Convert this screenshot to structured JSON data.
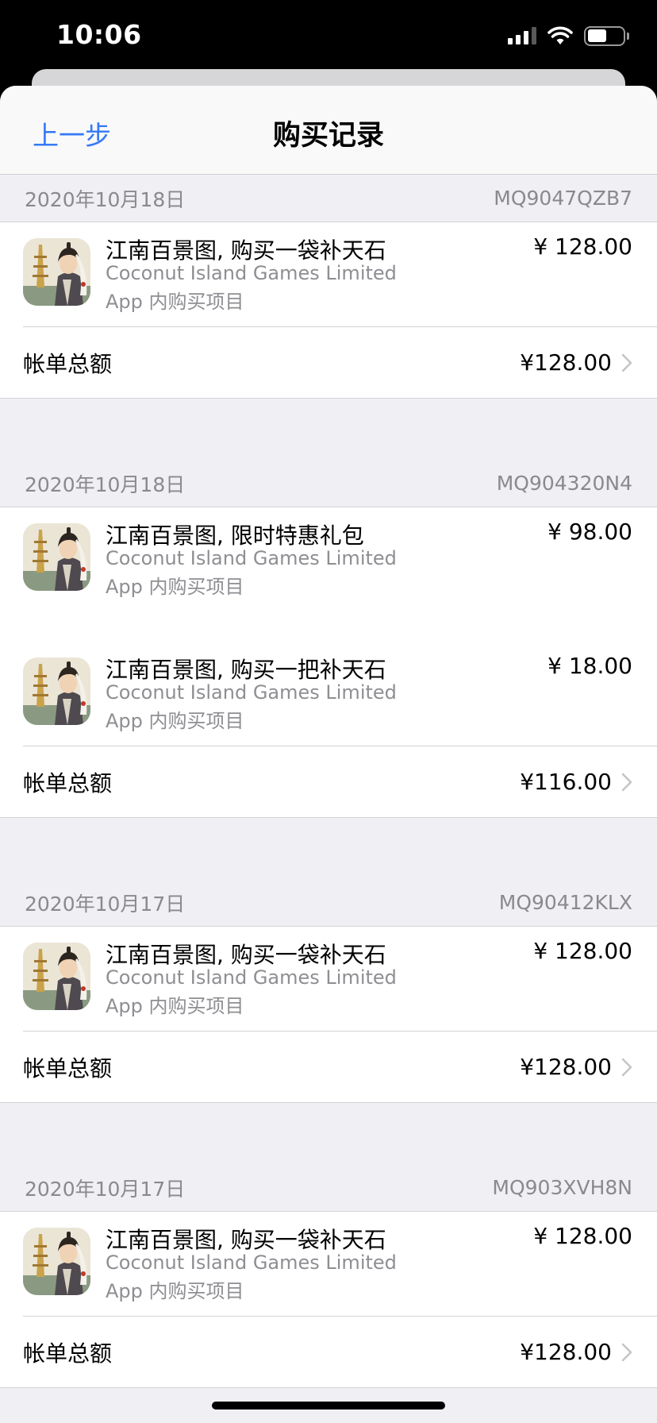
{
  "status_bar": {
    "time": "10:06"
  },
  "nav": {
    "back_label": "上一步",
    "title": "购买记录"
  },
  "sections": [
    {
      "date": "2020年10月18日",
      "order_id": "MQ9047QZB7",
      "items": [
        {
          "title": "江南百景图, 购买一袋补天石",
          "developer": "Coconut Island Games Limited",
          "type": "App 内购买项目",
          "price": "¥ 128.00"
        }
      ],
      "total_label": "帐单总额",
      "total_amount": "¥128.00"
    },
    {
      "date": "2020年10月18日",
      "order_id": "MQ904320N4",
      "items": [
        {
          "title": "江南百景图, 限时特惠礼包",
          "developer": "Coconut Island Games Limited",
          "type": "App 内购买项目",
          "price": "¥ 98.00"
        },
        {
          "title": "江南百景图, 购买一把补天石",
          "developer": "Coconut Island Games Limited",
          "type": "App 内购买项目",
          "price": "¥ 18.00"
        }
      ],
      "total_label": "帐单总额",
      "total_amount": "¥116.00"
    },
    {
      "date": "2020年10月17日",
      "order_id": "MQ90412KLX",
      "items": [
        {
          "title": "江南百景图, 购买一袋补天石",
          "developer": "Coconut Island Games Limited",
          "type": "App 内购买项目",
          "price": "¥ 128.00"
        }
      ],
      "total_label": "帐单总额",
      "total_amount": "¥128.00"
    },
    {
      "date": "2020年10月17日",
      "order_id": "MQ903XVH8N",
      "items": [
        {
          "title": "江南百景图, 购买一袋补天石",
          "developer": "Coconut Island Games Limited",
          "type": "App 内购买项目",
          "price": "¥ 128.00"
        }
      ],
      "total_label": "帐单总额",
      "total_amount": "¥128.00"
    }
  ],
  "icons": {
    "app_icon": "jiangnan-baijingtu-app-icon",
    "chevron": "chevron-right-icon"
  },
  "colors": {
    "accent": "#3478f6",
    "secondary_text": "#8e8e93",
    "background": "#efeff4"
  }
}
